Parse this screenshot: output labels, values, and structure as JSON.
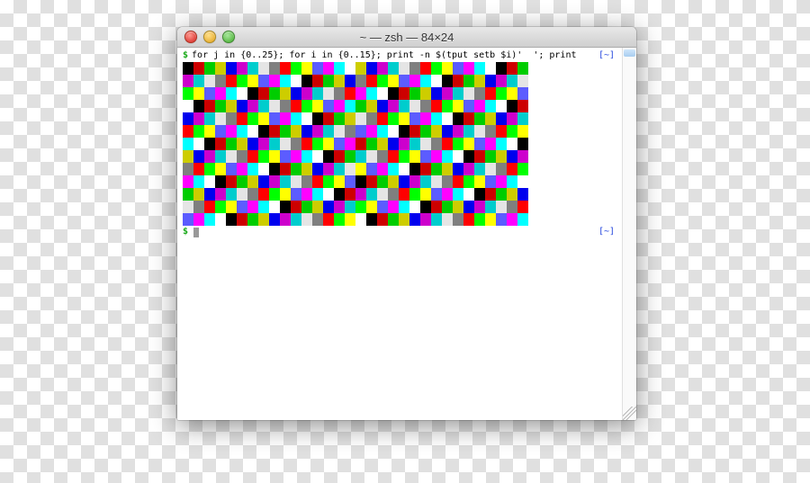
{
  "window": {
    "title": "~ — zsh — 84×24"
  },
  "prompt": {
    "symbol": "$",
    "cwd": "[~]"
  },
  "command": "for j in {0..25}; for i in {0..15}; print -n $(tput setb $i)'  '; print",
  "grid": {
    "rows": 13,
    "cols_per_block": 16,
    "blocks": 2,
    "colors": [
      "#000000",
      "#cd0000",
      "#00cd00",
      "#cdcd00",
      "#0000ee",
      "#cd00cd",
      "#00cdcd",
      "#e5e5e5",
      "#7f7f7f",
      "#ff0000",
      "#00ff00",
      "#ffff00",
      "#5c5cff",
      "#ff00ff",
      "#00ffff",
      "#ffffff"
    ]
  }
}
